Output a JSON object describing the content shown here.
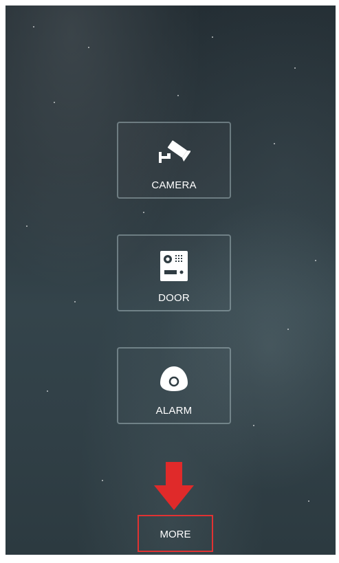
{
  "tiles": [
    {
      "label": "CAMERA",
      "icon": "camera-icon"
    },
    {
      "label": "DOOR",
      "icon": "door-intercom-icon"
    },
    {
      "label": "ALARM",
      "icon": "alarm-sensor-icon"
    }
  ],
  "more_button": {
    "label": "MORE",
    "highlight_color": "#e23232"
  },
  "annotation": {
    "icon": "arrow-down-icon",
    "color": "#e02a2a"
  },
  "colors": {
    "tile_border": "#b4c8cd",
    "text": "#ffffff"
  }
}
